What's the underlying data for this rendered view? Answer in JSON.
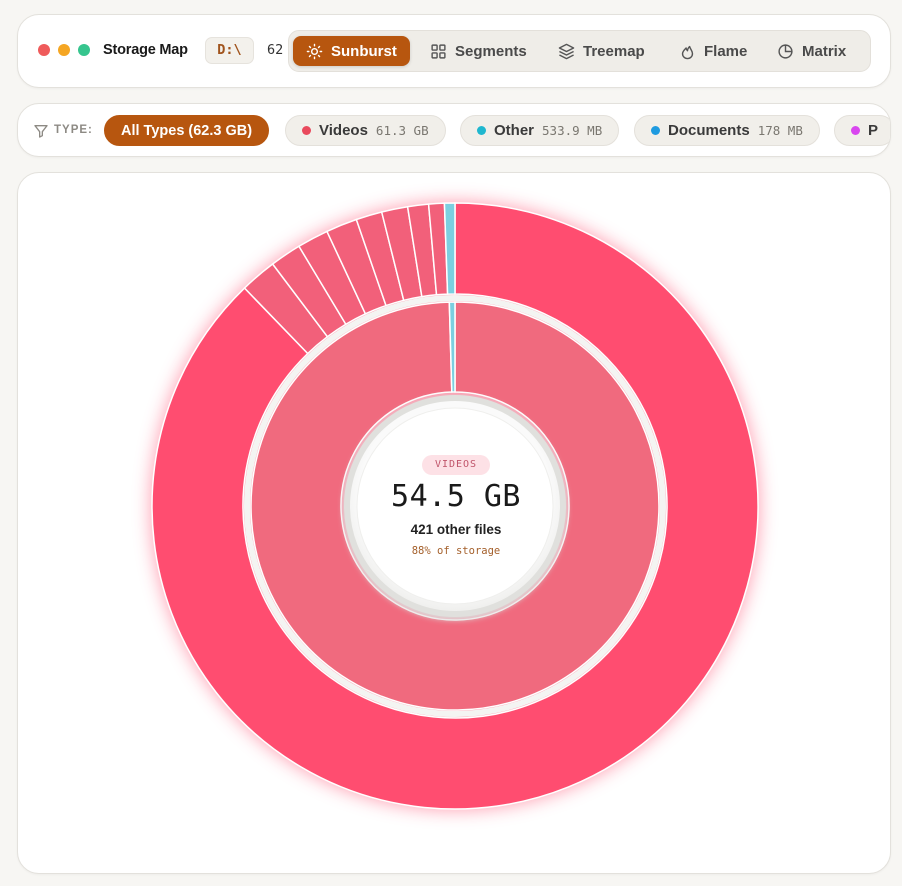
{
  "app": {
    "title": "Storage Map",
    "drive": "D:\\",
    "count_text": "62"
  },
  "window_controls": {
    "colors": [
      "#ef5b5b",
      "#f5a623",
      "#36c58e"
    ]
  },
  "views": {
    "items": [
      {
        "label": "Sunburst",
        "icon": "sun-icon",
        "active": true
      },
      {
        "label": "Segments",
        "icon": "grid-icon",
        "active": false
      },
      {
        "label": "Treemap",
        "icon": "layers-icon",
        "active": false
      },
      {
        "label": "Flame",
        "icon": "flame-icon",
        "active": false
      },
      {
        "label": "Matrix",
        "icon": "pie-icon",
        "active": false
      }
    ]
  },
  "filters": {
    "label": "TYPE:",
    "all_label": "All Types (62.3 GB)",
    "items": [
      {
        "name": "Videos",
        "size": "61.3 GB",
        "color": "#e94a5d"
      },
      {
        "name": "Other",
        "size": "533.9 MB",
        "color": "#1fb7cf"
      },
      {
        "name": "Documents",
        "size": "178 MB",
        "color": "#1f9be0"
      },
      {
        "name": "P",
        "size": "",
        "color": "#d946ef"
      }
    ]
  },
  "center": {
    "category": "VIDEOS",
    "size": "54.5 GB",
    "files": "421 other files",
    "percent": "88% of storage"
  },
  "colors": {
    "accent": "#b7560f",
    "videos_outer": "#ff4d70",
    "videos_inner": "#f06a7e",
    "other": "#7ccfe0"
  }
}
